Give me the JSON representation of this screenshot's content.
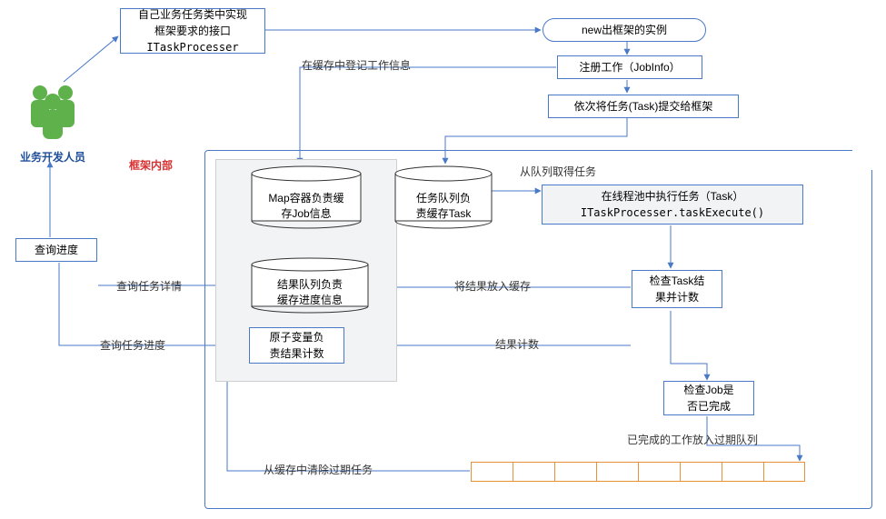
{
  "chart_data": {
    "type": "diagram",
    "title": "",
    "nodes": [
      {
        "id": "actor",
        "label": "业务开发人员",
        "type": "actor"
      },
      {
        "id": "implInterface",
        "label": "自己业务任务类中实现\n框架要求的接口\nITaskProcesser",
        "type": "process"
      },
      {
        "id": "newInstance",
        "label": "new出框架的实例",
        "type": "terminator"
      },
      {
        "id": "registerJob",
        "label": "注册工作（JobInfo）",
        "type": "process"
      },
      {
        "id": "submitTask",
        "label": "依次将任务(Task)提交给框架",
        "type": "process"
      },
      {
        "id": "framework",
        "label": "框架内部",
        "type": "boundary"
      },
      {
        "id": "mapJob",
        "label": "Map容器负责缓\n存Job信息",
        "type": "storage"
      },
      {
        "id": "taskQueue",
        "label": "任务队列负\n责缓存Task",
        "type": "storage"
      },
      {
        "id": "resultQueue",
        "label": "结果队列负责\n缓存进度信息",
        "type": "storage"
      },
      {
        "id": "atomicCount",
        "label": "原子变量负\n责结果计数",
        "type": "process"
      },
      {
        "id": "execTask",
        "label": "在线程池中执行任务（Task）\nITaskProcesser.taskExecute()",
        "type": "process"
      },
      {
        "id": "checkTask",
        "label": "检查Task结\n果并计数",
        "type": "process"
      },
      {
        "id": "checkJob",
        "label": "检查Job是\n否已完成",
        "type": "process"
      },
      {
        "id": "expiryQueue",
        "label": "",
        "type": "queue",
        "cells": 8
      },
      {
        "id": "queryProgress",
        "label": "查询进度",
        "type": "process"
      }
    ],
    "edges": [
      {
        "from": "actor",
        "to": "implInterface",
        "label": ""
      },
      {
        "from": "implInterface",
        "to": "newInstance",
        "label": ""
      },
      {
        "from": "newInstance",
        "to": "registerJob",
        "label": ""
      },
      {
        "from": "registerJob",
        "to": "mapJob",
        "label": "在缓存中登记工作信息"
      },
      {
        "from": "registerJob",
        "to": "submitTask",
        "label": ""
      },
      {
        "from": "submitTask",
        "to": "taskQueue",
        "label": ""
      },
      {
        "from": "taskQueue",
        "to": "execTask",
        "label": "从队列取得任务"
      },
      {
        "from": "execTask",
        "to": "checkTask",
        "label": ""
      },
      {
        "from": "checkTask",
        "to": "resultQueue",
        "label": "将结果放入缓存"
      },
      {
        "from": "checkTask",
        "to": "atomicCount",
        "label": "结果计数"
      },
      {
        "from": "checkTask",
        "to": "checkJob",
        "label": ""
      },
      {
        "from": "checkJob",
        "to": "expiryQueue",
        "label": "已完成的工作放入过期队列"
      },
      {
        "from": "expiryQueue",
        "to": "mapJob",
        "label": "从缓存中清除过期任务"
      },
      {
        "from": "queryProgress",
        "to": "resultQueue",
        "label": "查询任务详情"
      },
      {
        "from": "queryProgress",
        "to": "atomicCount",
        "label": "查询任务进度"
      },
      {
        "from": "queryProgress",
        "to": "actor",
        "label": ""
      }
    ]
  },
  "actor": {
    "label": "业务开发人员"
  },
  "implInterface": {
    "line1": "自己业务任务类中实现",
    "line2": "框架要求的接口",
    "line3": "ITaskProcesser"
  },
  "newInstance": {
    "label": "new出框架的实例"
  },
  "registerJob": {
    "label": "注册工作（JobInfo）"
  },
  "submitTask": {
    "label": "依次将任务(Task)提交给框架"
  },
  "frameworkLabel": "框架内部",
  "mapJob": {
    "line1": "Map容器负责缓",
    "line2": "存Job信息"
  },
  "taskQueue": {
    "line1": "任务队列负",
    "line2": "责缓存Task"
  },
  "resultQueue": {
    "line1": "结果队列负责",
    "line2": "缓存进度信息"
  },
  "atomicCount": {
    "line1": "原子变量负",
    "line2": "责结果计数"
  },
  "execTask": {
    "line1": "在线程池中执行任务（Task）",
    "line2": "ITaskProcesser.taskExecute()"
  },
  "checkTask": {
    "line1": "检查Task结",
    "line2": "果并计数"
  },
  "checkJob": {
    "line1": "检查Job是",
    "line2": "否已完成"
  },
  "queryProgress": {
    "label": "查询进度"
  },
  "labels": {
    "registerCache": "在缓存中登记工作信息",
    "getFromQueue": "从队列取得任务",
    "putResult": "将结果放入缓存",
    "countResult": "结果计数",
    "doneToExpiry": "已完成的工作放入过期队列",
    "clearExpired": "从缓存中清除过期任务",
    "queryDetail": "查询任务详情",
    "queryProg": "查询任务进度"
  }
}
